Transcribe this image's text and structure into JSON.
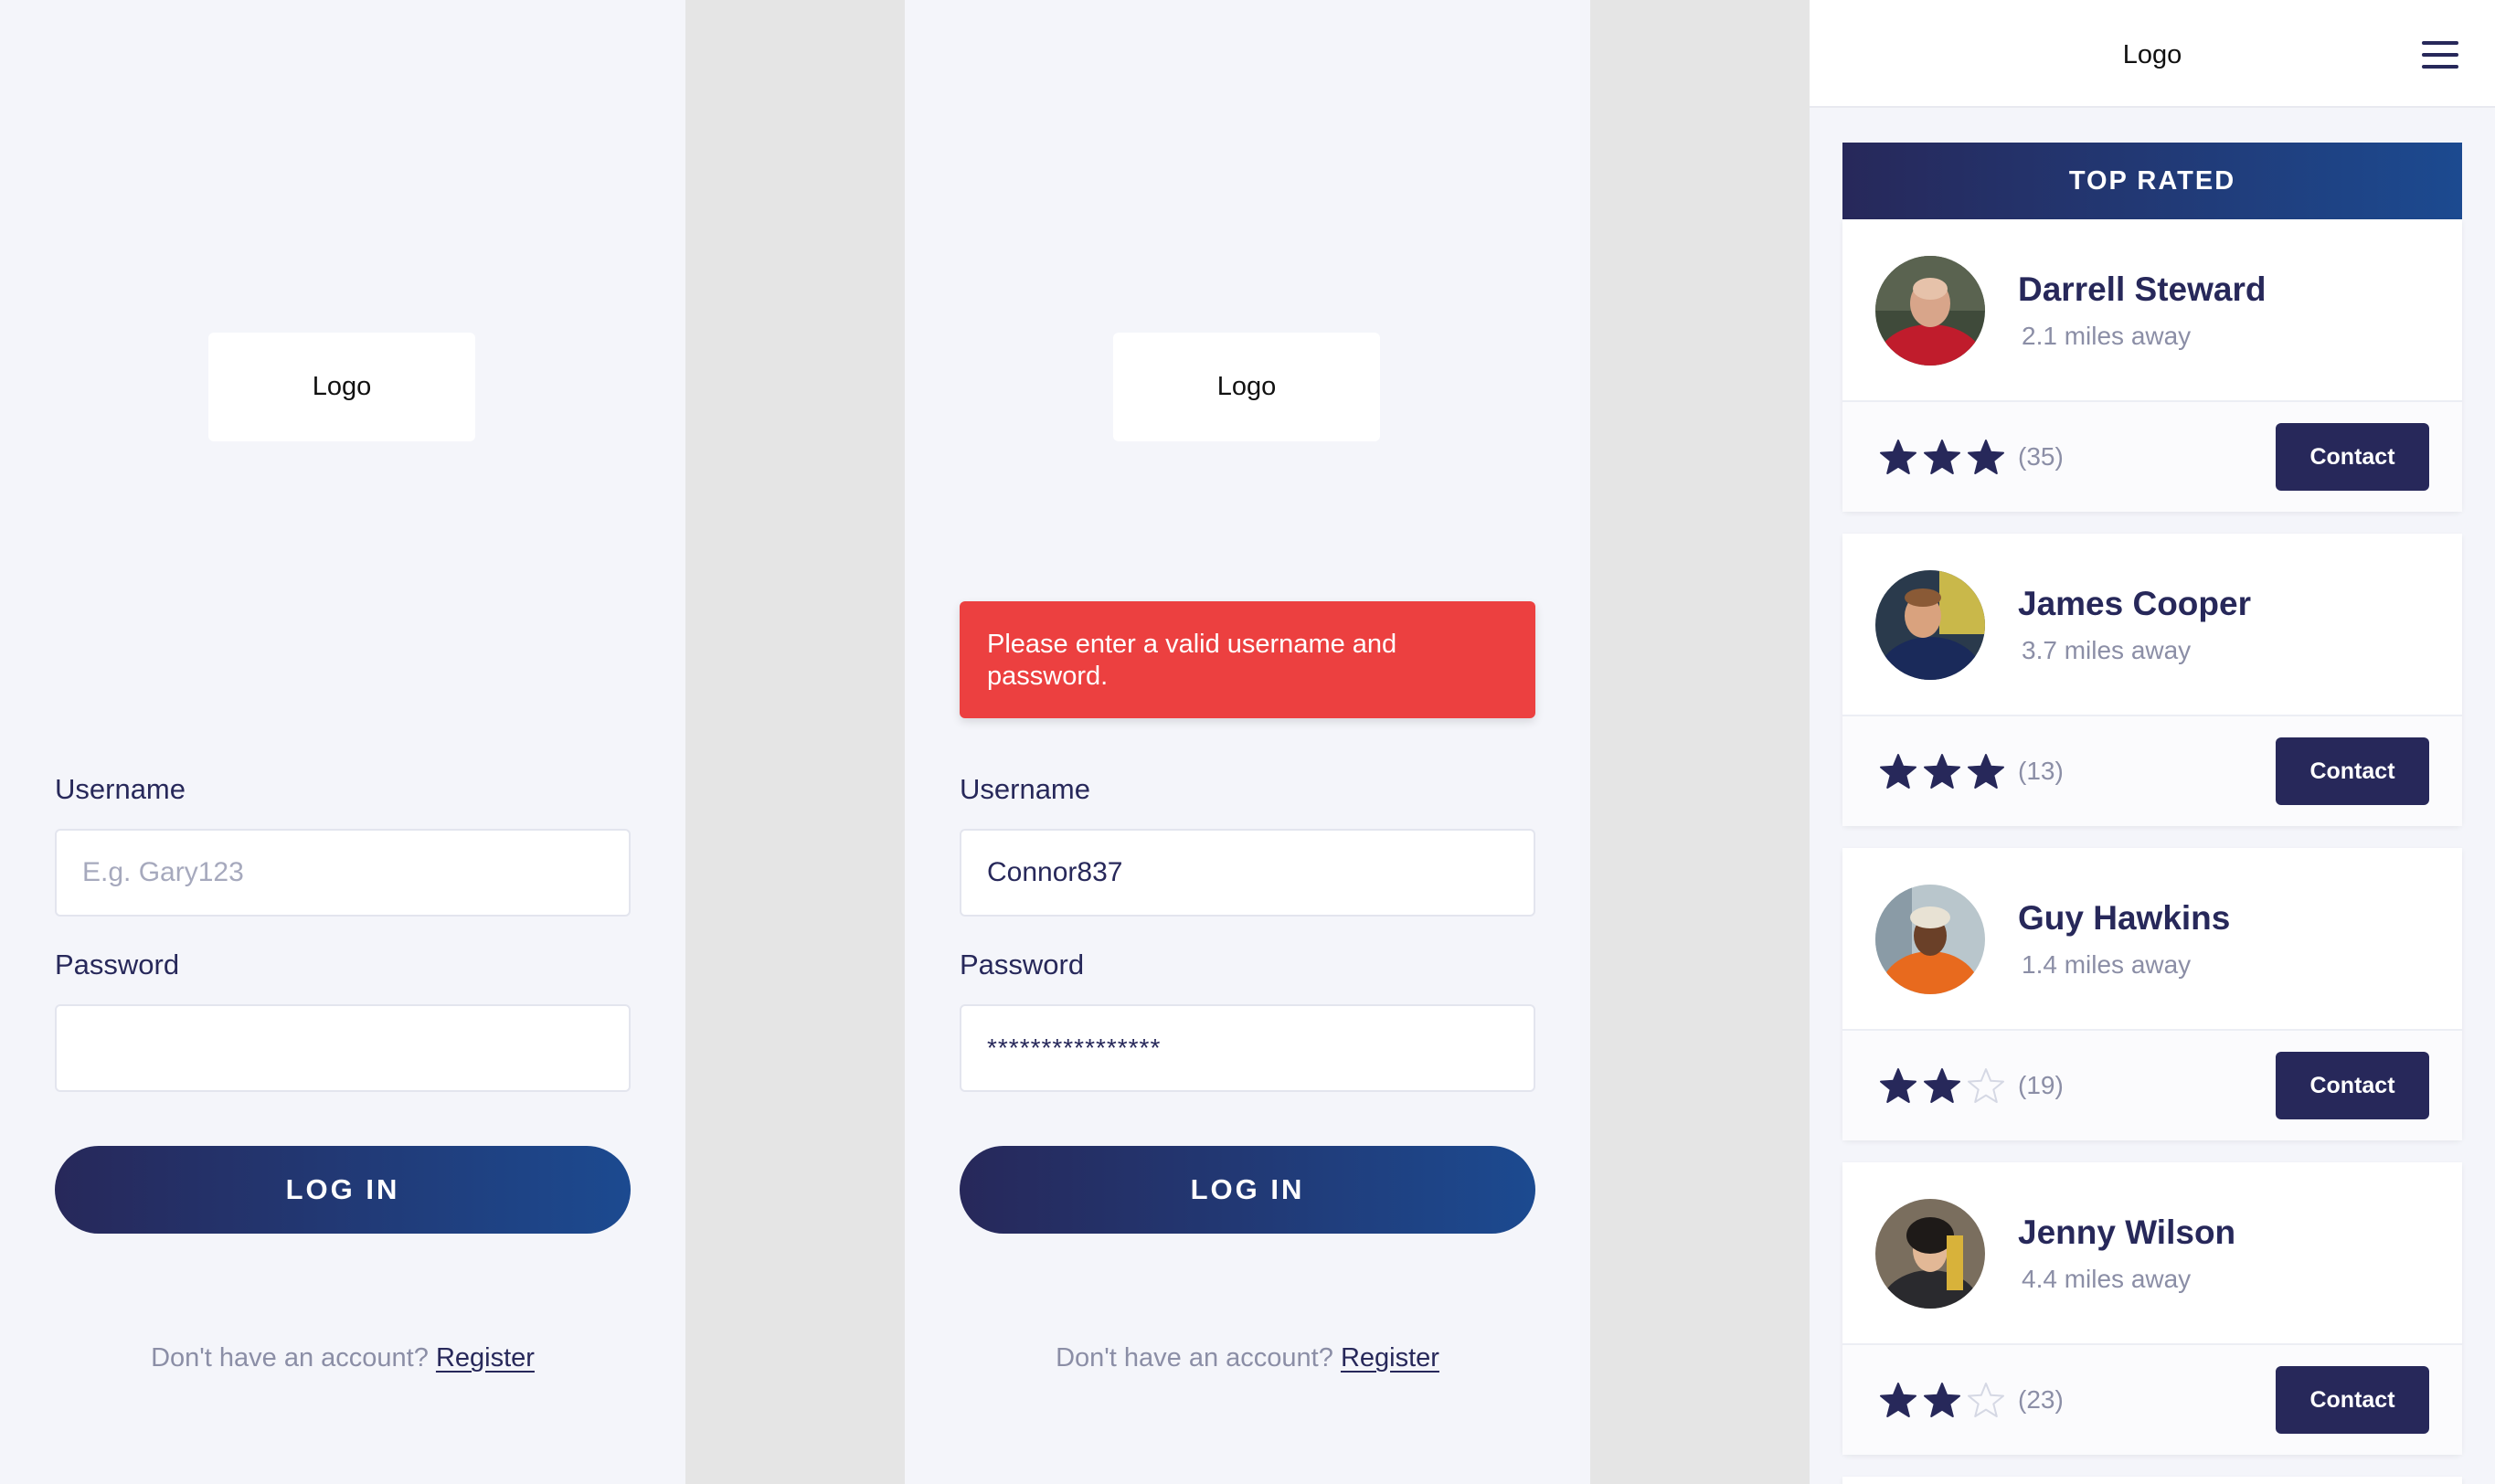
{
  "colors": {
    "primary": "#27285a",
    "accent": "#1c4a90",
    "error": "#ec4040",
    "background": "#f4f5fa"
  },
  "login": {
    "logo": "Logo",
    "username_label": "Username",
    "username_placeholder": "E.g. Gary123",
    "username_value": "",
    "password_label": "Password",
    "password_value": "",
    "login_button": "LOG IN",
    "register_prompt": "Don't have an account?",
    "register_link": "Register"
  },
  "login_error": {
    "logo": "Logo",
    "error_message": "Please enter a valid username and password.",
    "username_label": "Username",
    "username_value": "Connor837",
    "password_label": "Password",
    "password_value": "****************",
    "login_button": "LOG IN",
    "register_prompt": "Don't have an account?",
    "register_link": "Register"
  },
  "list": {
    "header_logo": "Logo",
    "menu_icon": "hamburger-menu-icon",
    "section_title": "TOP RATED",
    "people": [
      {
        "name": "Darrell Steward",
        "distance": "2.1 miles away",
        "rating": 3,
        "reviews": "(35)",
        "contact": "Contact"
      },
      {
        "name": "James Cooper",
        "distance": "3.7 miles away",
        "rating": 3,
        "reviews": "(13)",
        "contact": "Contact"
      },
      {
        "name": "Guy Hawkins",
        "distance": "1.4 miles away",
        "rating": 2,
        "reviews": "(19)",
        "contact": "Contact"
      },
      {
        "name": "Jenny Wilson",
        "distance": "4.4 miles away",
        "rating": 2,
        "reviews": "(23)",
        "contact": "Contact"
      }
    ]
  }
}
